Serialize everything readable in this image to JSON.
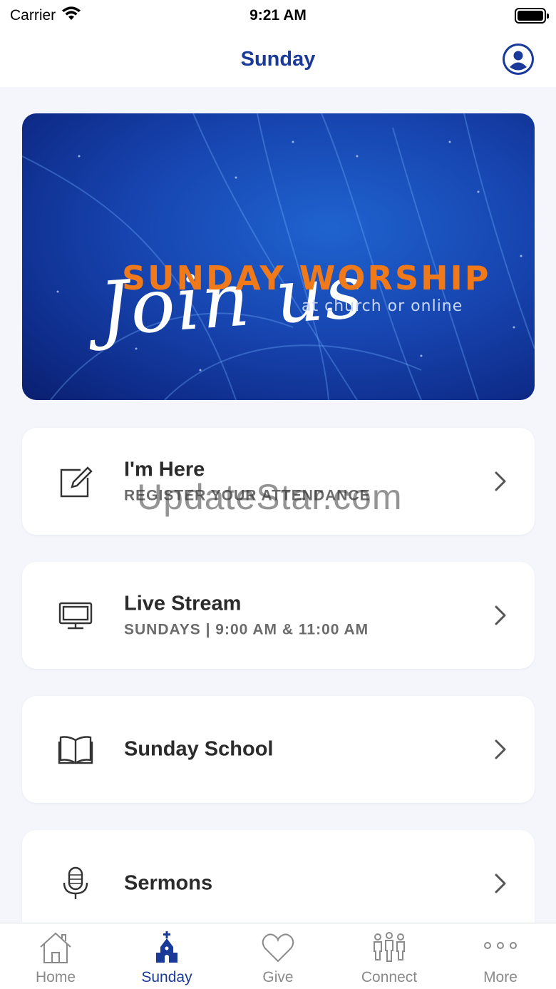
{
  "status_bar": {
    "carrier": "Carrier",
    "time": "9:21 AM"
  },
  "header": {
    "title": "Sunday"
  },
  "banner": {
    "script_text": "Join us",
    "headline": "SUNDAY WORSHIP",
    "subline": "at church or online",
    "colors": {
      "background": "#1745b0",
      "headline": "#f07a1a"
    }
  },
  "cards": [
    {
      "title": "I'm Here",
      "subtitle": "REGISTER YOUR ATTENDANCE",
      "icon": "edit-icon"
    },
    {
      "title": "Live Stream",
      "subtitle": "SUNDAYS | 9:00 AM & 11:00 AM",
      "icon": "monitor-icon"
    },
    {
      "title": "Sunday School",
      "subtitle": "",
      "icon": "book-icon"
    },
    {
      "title": "Sermons",
      "subtitle": "",
      "icon": "microphone-icon"
    }
  ],
  "watermark": "UpdateStar.com",
  "tab_bar": {
    "items": [
      {
        "label": "Home",
        "icon": "home-icon",
        "active": false
      },
      {
        "label": "Sunday",
        "icon": "church-icon",
        "active": true
      },
      {
        "label": "Give",
        "icon": "heart-icon",
        "active": false
      },
      {
        "label": "Connect",
        "icon": "people-icon",
        "active": false
      },
      {
        "label": "More",
        "icon": "more-icon",
        "active": false
      }
    ]
  },
  "colors": {
    "accent": "#1a3a99",
    "inactive": "#8a8a8a",
    "background": "#f4f6fb"
  }
}
